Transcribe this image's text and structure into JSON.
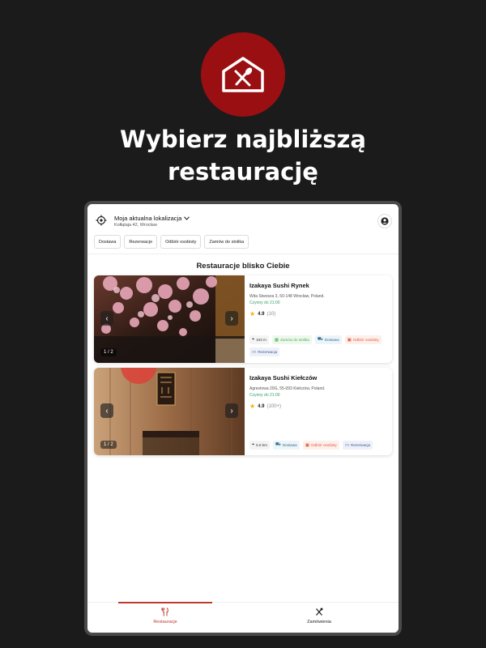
{
  "headline_line1": "Wybierz najbliższą",
  "headline_line2": "restaurację",
  "location": {
    "title": "Moja aktualna lokalizacja",
    "address": "Kołłątaja 42, Wrocław"
  },
  "chips": [
    "Dostawa",
    "Rezerwacje",
    "Odbiór osobisty",
    "Zamów do stolika"
  ],
  "section_title": "Restauracje blisko Ciebie",
  "restaurants": [
    {
      "name": "Izakaya Sushi Rynek",
      "address": "Wita Stwosza 3, 50-148 Wrocław, Poland.",
      "open": "Czynny do 21:00",
      "rating": "4.9",
      "reviews": "(10)",
      "pager": "1 / 2",
      "tags": [
        "103 m",
        "Zamów do stolika",
        "Dostawa",
        "Odbiór osobisty",
        "Rezerwacja"
      ]
    },
    {
      "name": "Izakaya Sushi Kiełczów",
      "address": "Agrestowa 20G, 55-093 Kiełczów, Poland.",
      "open": "Czynny do 21:00",
      "rating": "4.9",
      "reviews": "(100+)",
      "pager": "1 / 2",
      "tags": [
        "5.6 km",
        "Dostawa",
        "Odbiór osobisty",
        "Rezerwacja"
      ]
    }
  ],
  "nav": {
    "restaurants": "Restauracje",
    "orders": "Zamówienia"
  },
  "colors": {
    "brand": "#9a0f12",
    "background": "#1c1b1c",
    "open_green": "#38a169"
  }
}
